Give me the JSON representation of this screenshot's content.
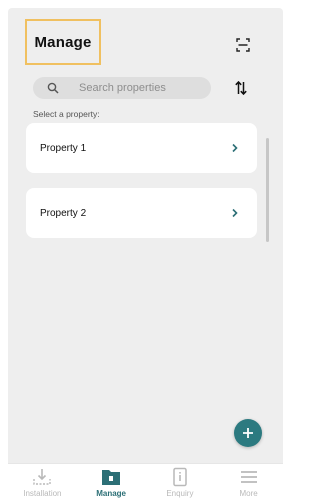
{
  "header": {
    "title": "Manage",
    "scan_icon": "qr-scan-icon"
  },
  "search": {
    "placeholder": "Search properties",
    "icon": "search-icon",
    "sort_icon": "sort-icon"
  },
  "section_label": "Select a property:",
  "properties": [
    {
      "label": "Property 1"
    },
    {
      "label": "Property 2"
    }
  ],
  "fab": {
    "icon": "plus-icon"
  },
  "bottom_nav": {
    "items": [
      {
        "label": "Installation",
        "icon": "download-icon",
        "active": false
      },
      {
        "label": "Manage",
        "icon": "folder-icon",
        "active": true
      },
      {
        "label": "Enquiry",
        "icon": "info-icon",
        "active": false
      },
      {
        "label": "More",
        "icon": "menu-icon",
        "active": false
      }
    ]
  },
  "colors": {
    "accent": "#2c7a80",
    "highlight_border": "#f0c060",
    "background": "#eeeeee",
    "inactive_nav": "#b9b9b9"
  }
}
